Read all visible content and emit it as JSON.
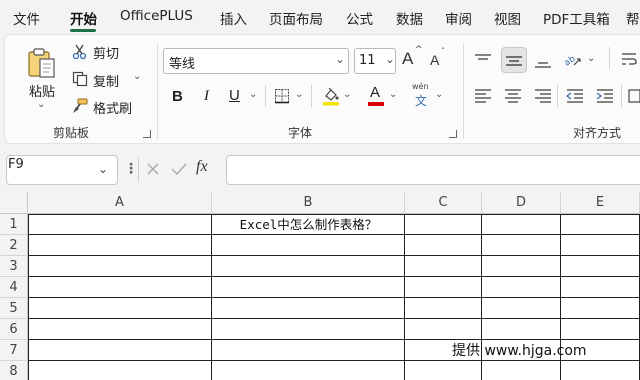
{
  "tabs": [
    "文件",
    "开始",
    "OfficePLUS",
    "插入",
    "页面布局",
    "公式",
    "数据",
    "审阅",
    "视图",
    "PDF工具箱",
    "帮"
  ],
  "active_tab": "开始",
  "ribbon": {
    "clipboard": {
      "group_label": "剪贴板",
      "paste": "粘贴",
      "cut": "剪切",
      "copy": "复制",
      "format_painter": "格式刷"
    },
    "font": {
      "group_label": "字体",
      "font_name": "等线",
      "font_size": "11",
      "bold": "B",
      "italic": "I",
      "underline": "U",
      "wen": "wén",
      "wen2": "文",
      "grow": "A",
      "shrink": "A",
      "font_color_letter": "A"
    },
    "alignment": {
      "group_label": "对齐方式"
    },
    "colors": {
      "highlight": "#f2e600",
      "font_color": "#d40000",
      "accent": "#1e7145"
    }
  },
  "formula_bar": {
    "name_box": "F9",
    "fx": "fx",
    "content": ""
  },
  "sheet": {
    "columns": [
      "A",
      "B",
      "C",
      "D",
      "E"
    ],
    "rows": [
      "1",
      "2",
      "3",
      "4",
      "5",
      "6",
      "7",
      "8"
    ],
    "b1": "Excel中怎么制作表格？",
    "watermark": "提供 www.hjga.com"
  }
}
